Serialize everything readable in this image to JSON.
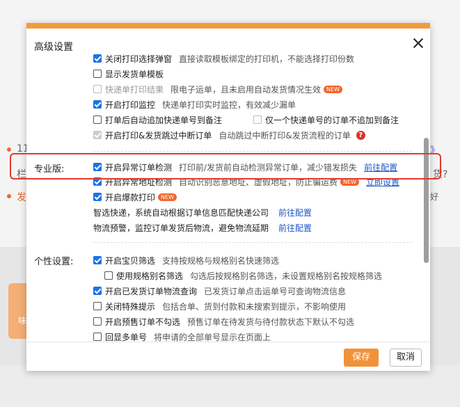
{
  "background": {
    "fragments": [
      "11",
      "栏",
      "发",
      "》",
      "货?",
      "好"
    ]
  },
  "modal": {
    "title": "高级设置",
    "sections": {
      "pro_label": "专业版:",
      "personal_label": "个性设置:"
    },
    "rows_top": [
      {
        "label": "关闭打印选择弹窗",
        "desc": "直接读取模板绑定的打印机，不能选择打印份数"
      },
      {
        "label": "显示发货单模板",
        "desc": ""
      },
      {
        "label": "快递单打印结果",
        "desc": "限电子运单，且未启用自动发货情况生效",
        "badge": "NEW"
      },
      {
        "label": "开启打印监控",
        "desc": "快递单打印实时监控，有效减少漏单"
      },
      {
        "label": "打单后自动追加快递单号到备注",
        "desc": ""
      },
      {
        "label": "仅一个快递单号的订单不追加到备注",
        "desc": ""
      },
      {
        "label": "开启打印&发货跳过中断订单",
        "desc": "自动跳过中断打印&发货流程的订单",
        "help": "?"
      }
    ],
    "rows_pro": [
      {
        "label": "开启异常订单检测",
        "desc": "打印前/发货前自动检测异常订单，减少错发损失",
        "link": "前往配置"
      },
      {
        "label": "开启异常地址检测",
        "desc": "自动识别恶意地址、虚假地址，防止骗运费",
        "badge": "NEW",
        "link": "立即设置"
      },
      {
        "label": "开启爆款打印",
        "badge": "NEW"
      }
    ],
    "plain_pro": [
      {
        "text": "智选快递，系统自动根据订单信息匹配快递公司",
        "link": "前往配置"
      },
      {
        "text": "物流预警，监控订单发货后物流，避免物流延期",
        "link": "前往配置"
      }
    ],
    "rows_personal": [
      {
        "label": "开启宝贝筛选",
        "desc": "支持按规格与规格别名快速筛选"
      },
      {
        "label": "使用规格别名筛选",
        "desc": "勾选后按规格别名筛选，未设置规格别名按规格筛选"
      },
      {
        "label": "开启已发货订单物流查询",
        "desc": "已发货订单点击运单号可查询物流信息"
      },
      {
        "label": "关闭特殊提示",
        "desc": "包括合单、货到付款和未搜索到提示，不影响使用"
      },
      {
        "label": "开启预售订单不勾选",
        "desc": "预售订单在待发货与待付款状态下默认不勾选"
      },
      {
        "label": "回显多单号",
        "desc": "将申请的全部单号显示在页面上"
      }
    ],
    "footer": {
      "save": "保存",
      "cancel": "取消"
    }
  },
  "colors": {
    "accent": "#f0923a",
    "link": "#1a56c8",
    "checkbox": "#1a73e8",
    "highlight": "#e23a2e",
    "badge": "#f3652b"
  }
}
